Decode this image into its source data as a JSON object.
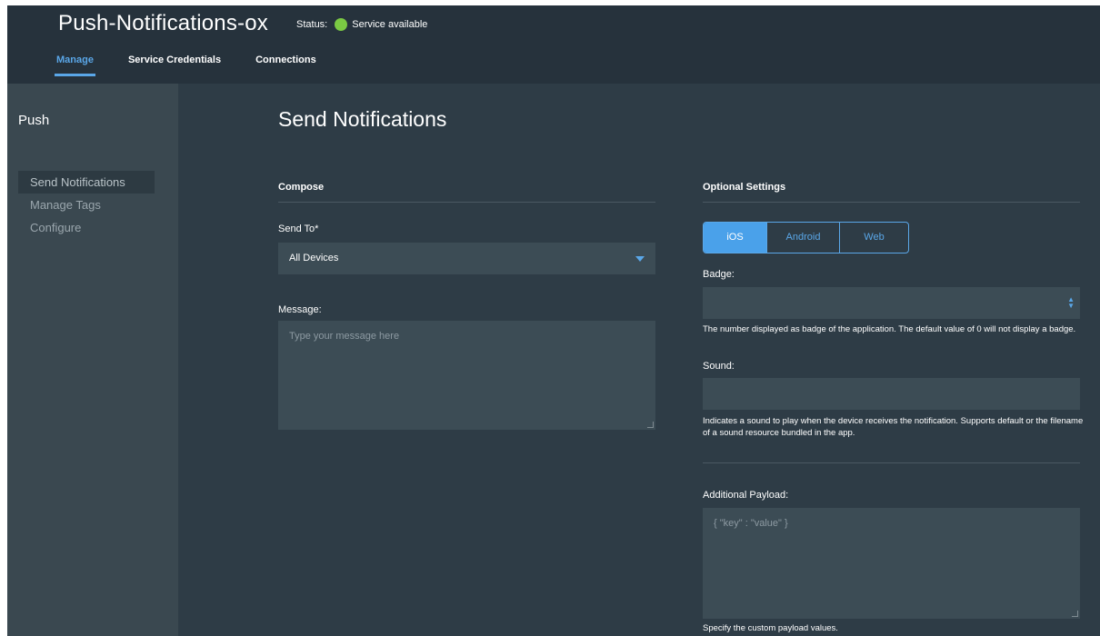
{
  "header": {
    "app_title": "Push-Notifications-ox",
    "status_label": "Status:",
    "status_text": "Service available",
    "status_color": "#7ac943",
    "tabs": [
      {
        "label": "Manage",
        "active": true
      },
      {
        "label": "Service Credentials",
        "active": false
      },
      {
        "label": "Connections",
        "active": false
      }
    ]
  },
  "sidebar": {
    "title": "Push",
    "items": [
      {
        "label": "Send Notifications",
        "active": true
      },
      {
        "label": "Manage Tags",
        "active": false
      },
      {
        "label": "Configure",
        "active": false
      }
    ]
  },
  "main": {
    "title": "Send Notifications",
    "compose": {
      "heading": "Compose",
      "send_to_label": "Send To*",
      "send_to_value": "All Devices",
      "message_label": "Message:",
      "message_placeholder": "Type your message here"
    },
    "optional": {
      "heading": "Optional Settings",
      "platform_tabs": [
        {
          "label": "iOS",
          "active": true
        },
        {
          "label": "Android",
          "active": false
        },
        {
          "label": "Web",
          "active": false
        }
      ],
      "badge_label": "Badge:",
      "badge_help": "The number displayed as badge of the application. The default value of 0 will not display a badge.",
      "sound_label": "Sound:",
      "sound_help": "Indicates a sound to play when the device receives the notification. Supports default or the filename of a sound resource bundled in the app.",
      "payload_label": "Additional Payload:",
      "payload_placeholder": "{ \"key\" : \"value\" }",
      "payload_help": "Specify the custom payload values."
    }
  },
  "colors": {
    "accent": "#5aa7e8",
    "background": "#2e3c46",
    "header": "#26323c",
    "sidebar": "#3a4850",
    "input": "#3c4c55"
  }
}
